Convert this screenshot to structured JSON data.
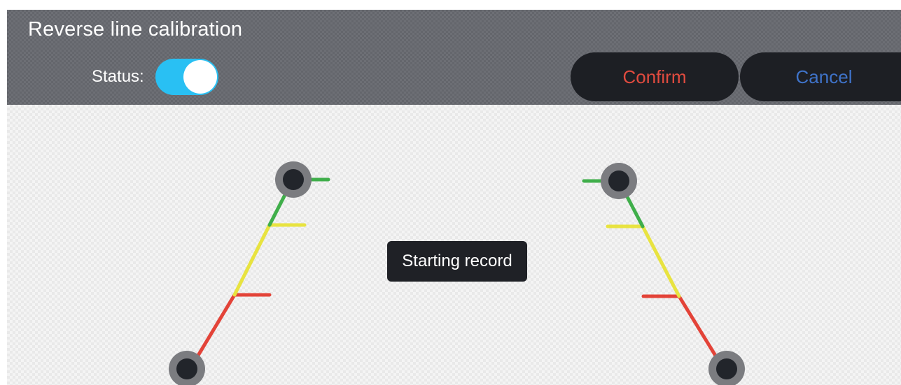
{
  "header": {
    "title": "Reverse line calibration",
    "status_label": "Status:",
    "status_on": true,
    "confirm_label": "Confirm",
    "cancel_label": "Cancel"
  },
  "toast": {
    "text": "Starting record"
  },
  "colors": {
    "header_bg": "#6d6f75",
    "toggle_on": "#29c0f3",
    "confirm_text": "#e14b3f",
    "cancel_text": "#3f73c9",
    "green_line": "#3fae4a",
    "yellow_line": "#e8e340",
    "red_line": "#e34338",
    "handle_ring": "#7b7c80",
    "handle_core": "#22252b"
  }
}
